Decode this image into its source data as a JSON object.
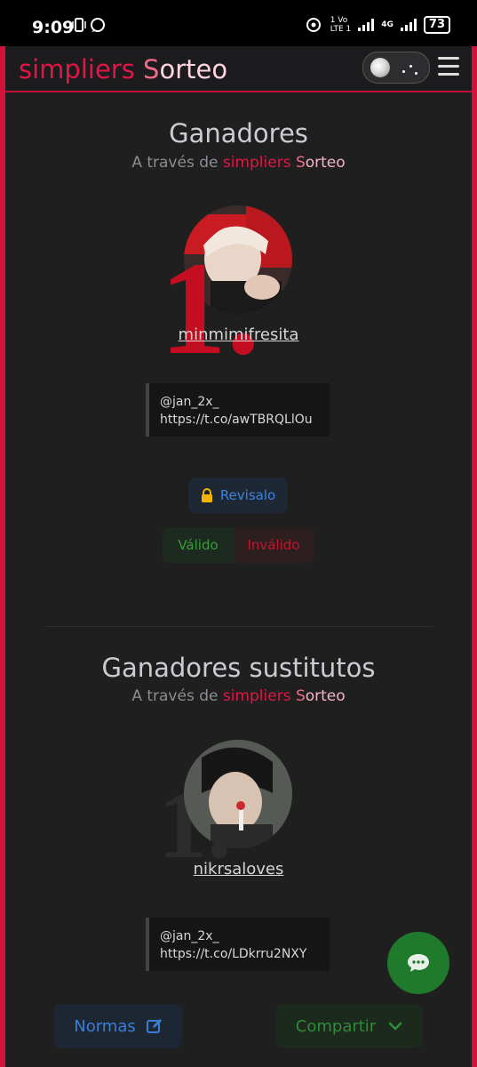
{
  "status_bar": {
    "time": "9:09",
    "network_label_top": "1 Vo",
    "network_label_bottom": "LTE 1",
    "network_4g": "4G",
    "battery": "73"
  },
  "navbar": {
    "brand_part1": "simpliers ",
    "brand_part2": "S",
    "brand_part3": "orteo"
  },
  "winners": {
    "title": "Ganadores",
    "subtitle_prefix": "A través de ",
    "subtitle_brand1": "simpliers ",
    "subtitle_brand2": "S",
    "subtitle_brand3": "orteo",
    "items": [
      {
        "rank": "1.",
        "username": "minmimifresita",
        "tweet_handle": "@jan_2x_",
        "tweet_link": "https://t.co/awTBRQLlOu"
      }
    ],
    "review_label": "Revisalo",
    "valid_label": "Válido",
    "invalid_label": "Inválido"
  },
  "substitutes": {
    "title": "Ganadores sustitutos",
    "subtitle_prefix": "A través de ",
    "subtitle_brand1": "simpliers ",
    "subtitle_brand2": "S",
    "subtitle_brand3": "orteo",
    "items": [
      {
        "rank": "1.",
        "username": "nikrsaloves",
        "tweet_handle": "@jan_2x_",
        "tweet_link": "https://t.co/LDkrru2NXY"
      }
    ]
  },
  "footer": {
    "rules_label": "Normas",
    "share_label": "Compartir"
  },
  "colors": {
    "accent_red": "#e21646",
    "valid_green": "#3a9a3a",
    "link_blue": "#3a84e0",
    "fab_green": "#1f7a2b"
  },
  "icons": {
    "lock": "lock-icon",
    "edit": "edit-icon",
    "chevron": "chevron-down-icon",
    "chat": "chat-icon",
    "menu": "hamburger-icon",
    "theme": "theme-toggle-icon"
  }
}
